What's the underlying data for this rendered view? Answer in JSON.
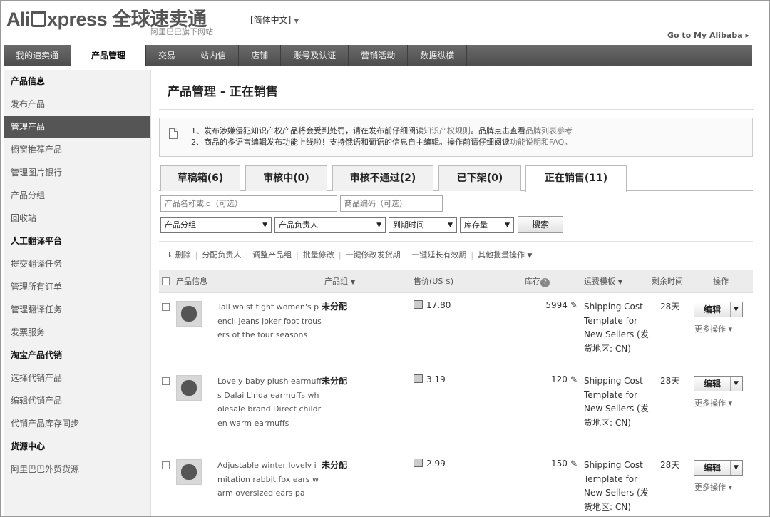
{
  "header": {
    "logo_left": "Ali",
    "logo_right": "xpress",
    "logo_cn": "全球速卖通",
    "logo_sub": "阿里巴巴旗下网站",
    "language": "[简体中文]",
    "goto": "Go to My Alibaba ▸"
  },
  "nav": [
    {
      "label": "我的速卖通"
    },
    {
      "label": "产品管理",
      "active": true
    },
    {
      "label": "交易"
    },
    {
      "label": "站内信"
    },
    {
      "label": "店铺"
    },
    {
      "label": "账号及认证"
    },
    {
      "label": "营销活动"
    },
    {
      "label": "数据纵横"
    }
  ],
  "sidebar": {
    "groups": [
      {
        "title": "产品信息",
        "items": [
          "发布产品",
          "管理产品",
          "橱窗推荐产品",
          "管理图片银行",
          "产品分组",
          "回收站"
        ]
      },
      {
        "title": "人工翻译平台",
        "items": [
          "提交翻译任务",
          "管理所有订单",
          "管理翻译任务",
          "发票服务"
        ]
      },
      {
        "title": "淘宝产品代销",
        "items": [
          "选择代销产品",
          "编辑代销产品",
          "代销产品库存同步"
        ]
      },
      {
        "title": "货源中心",
        "items": [
          "阿里巴巴外贸货源"
        ]
      }
    ],
    "active_item": "管理产品"
  },
  "main": {
    "title": "产品管理 - 正在销售",
    "notice": {
      "line1_text": "1、发布涉嫌侵犯知识产权产品将会受到处罚，请在发布前仔细阅读",
      "line1_link1": "知识产权规则",
      "line1_mid": "。品牌点击查看",
      "line1_link2": "品牌列表参考",
      "line2_text": "2、商品的多语言编辑发布功能上线啦！支持俄语和葡语的信息自主编辑。操作前请仔细阅读",
      "line2_link": "功能说明和FAQ",
      "line2_end": "。"
    },
    "tabs": [
      "草稿箱(6)",
      "审核中(0)",
      "审核不通过(2)",
      "已下架(0)",
      "正在销售(11)"
    ],
    "active_tab": 4,
    "filters": {
      "name_placeholder": "产品名称或id（可选）",
      "code_placeholder": "商品编码（可选）",
      "group_select": "产品分组",
      "owner_select": "产品负责人",
      "expire_select": "到期时间",
      "stock_select": "库存量",
      "search_button": "搜索"
    },
    "toolbar": [
      "删除",
      "分配负责人",
      "调整产品组",
      "批量修改",
      "一键修改发货期",
      "一键延长有效期",
      "其他批量操作"
    ],
    "table": {
      "headers": {
        "info": "产品信息",
        "group": "产品组",
        "price": "售价(US $)",
        "stock": "库存",
        "shipping": "运费模板",
        "remaining": "剩余时间",
        "action": "操作"
      },
      "rows": [
        {
          "name": "Tall waist tight women's pencil jeans joker foot trousers of the four seasons",
          "group": "未分配",
          "price": "17.80",
          "stock": "5994",
          "shipping": "Shipping Cost Template for New Sellers (发货地区: CN)",
          "remaining": "28天",
          "edit": "编辑",
          "more": "更多操作"
        },
        {
          "name": "Lovely baby plush earmuffs Dalai Linda earmuffs wholesale brand Direct children warm earmuffs",
          "group": "未分配",
          "price": "3.19",
          "stock": "120",
          "shipping": "Shipping Cost Template for New Sellers (发货地区: CN)",
          "remaining": "28天",
          "edit": "编辑",
          "more": "更多操作"
        },
        {
          "name": "Adjustable winter lovely imitation rabbit fox ears warm oversized ears pa",
          "group": "未分配",
          "price": "2.99",
          "stock": "150",
          "shipping": "Shipping Cost Template for New Sellers (发货地区: CN)",
          "remaining": "28天",
          "edit": "编辑",
          "more": "更多操作"
        }
      ]
    }
  },
  "icons": [
    "cart-icon",
    "document-icon",
    "help-icon",
    "pencil-icon",
    "price-icon",
    "caret-down-icon",
    "delete-icon"
  ]
}
